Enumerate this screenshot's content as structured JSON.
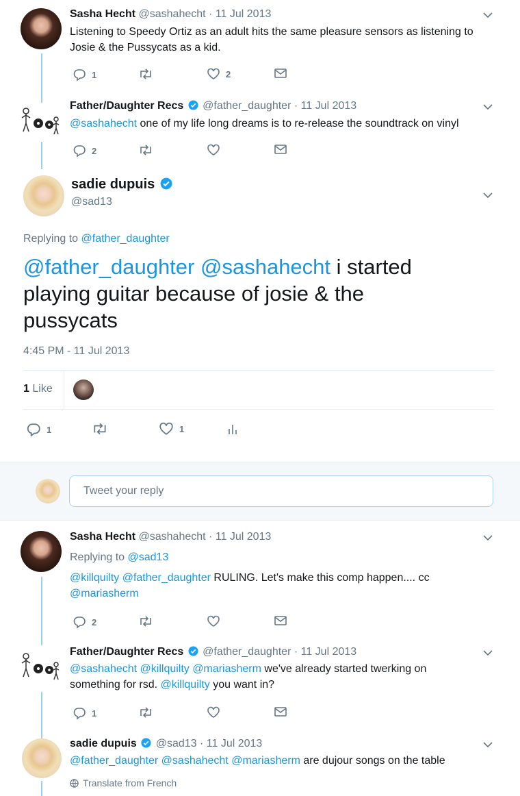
{
  "tweet1": {
    "name": "Sasha Hecht",
    "handle": "@sashahecht",
    "date": "11 Jul 2013",
    "text": "Listening to Speedy Ortiz as an adult hits the same pleasure sensors as listening to Josie & the Pussycats as a kid.",
    "replies": "1",
    "likes": "2"
  },
  "tweet2": {
    "name": "Father/Daughter Recs",
    "handle": "@father_daughter",
    "date": "11 Jul 2013",
    "mention": "@sashahecht",
    "text": " one of my life long dreams is to re-release the soundtrack on vinyl",
    "replies": "2"
  },
  "main": {
    "name": "sadie dupuis",
    "handle": "@sad13",
    "replying_prefix": "Replying to ",
    "replying_to": "@father_daughter",
    "mention1": "@father_daughter",
    "mention2": "@sashahecht",
    "text_line1_tail": " i started",
    "text_line2": "playing guitar because of josie & the",
    "text_line3": "pussycats",
    "timestamp": "4:45 PM - 11 Jul 2013",
    "likes_count": "1",
    "likes_label": "Like",
    "replies": "1",
    "likes": "1"
  },
  "reply_box": {
    "placeholder": "Tweet your reply"
  },
  "tweet3": {
    "name": "Sasha Hecht",
    "handle": "@sashahecht",
    "date": "11 Jul 2013",
    "replying_prefix": "Replying to ",
    "replying_to": "@sad13",
    "mention1": "@killquilty",
    "mention2": "@father_daughter",
    "text": " RULING. Let's make this comp happen.... cc",
    "mention3": "@mariasherm",
    "replies": "2"
  },
  "tweet4": {
    "name": "Father/Daughter Recs",
    "handle": "@father_daughter",
    "date": "11 Jul 2013",
    "mention1": "@sashahecht",
    "mention2": "@killquilty",
    "mention3": "@mariasherm",
    "text1": " we've already started twerking on",
    "text2_pre": "something for rsd. ",
    "mention4": "@killquilty",
    "text2_post": " you want in?",
    "replies": "1"
  },
  "tweet5": {
    "name": "sadie dupuis",
    "handle": "@sad13",
    "date": "11 Jul 2013",
    "mention1": "@father_daughter",
    "mention2": "@sashahecht",
    "mention3": "@mariasherm",
    "text": " are dujour songs on the table",
    "translate": "Translate from French"
  },
  "sep": "·",
  "colors": {
    "link": "#1b95e0",
    "muted": "#657786",
    "thread_line": "#9bd0e6",
    "verified": "#1da1f2"
  },
  "icons": [
    "reply-icon",
    "retweet-icon",
    "like-icon",
    "dm-icon",
    "analytics-icon",
    "chevron-down-icon",
    "verified-icon",
    "globe-icon"
  ]
}
